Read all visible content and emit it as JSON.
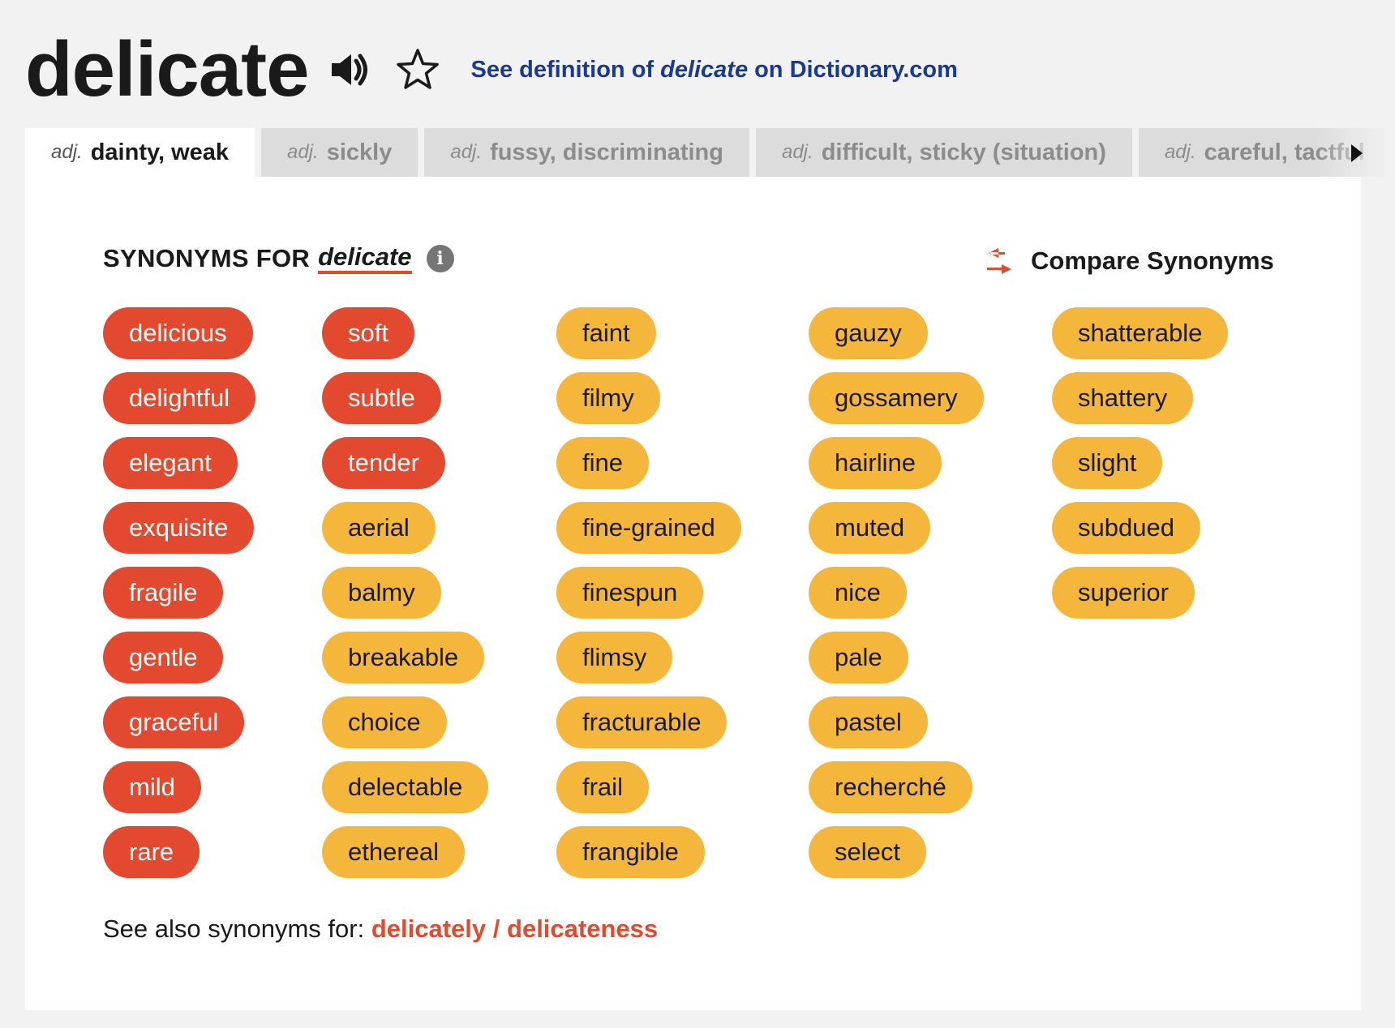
{
  "header": {
    "word": "delicate",
    "definition_link": {
      "prefix": "See definition of",
      "word": "delicate",
      "suffix": "on Dictionary.com"
    }
  },
  "tabs": [
    {
      "pos": "adj.",
      "label": "dainty, weak",
      "active": true
    },
    {
      "pos": "adj.",
      "label": "sickly",
      "active": false
    },
    {
      "pos": "adj.",
      "label": "fussy, discriminating",
      "active": false
    },
    {
      "pos": "adj.",
      "label": "difficult, sticky (situation)",
      "active": false
    },
    {
      "pos": "adj.",
      "label": "careful, tactful",
      "active": false
    }
  ],
  "synonyms_heading": {
    "label": "SYNONYMS FOR",
    "word": "delicate",
    "info_glyph": "i"
  },
  "compare": {
    "label": "Compare Synonyms"
  },
  "columns": [
    [
      {
        "word": "delicious",
        "strength": "strong"
      },
      {
        "word": "delightful",
        "strength": "strong"
      },
      {
        "word": "elegant",
        "strength": "strong"
      },
      {
        "word": "exquisite",
        "strength": "strong"
      },
      {
        "word": "fragile",
        "strength": "strong"
      },
      {
        "word": "gentle",
        "strength": "strong"
      },
      {
        "word": "graceful",
        "strength": "strong"
      },
      {
        "word": "mild",
        "strength": "strong"
      },
      {
        "word": "rare",
        "strength": "strong"
      }
    ],
    [
      {
        "word": "soft",
        "strength": "strong"
      },
      {
        "word": "subtle",
        "strength": "strong"
      },
      {
        "word": "tender",
        "strength": "strong"
      },
      {
        "word": "aerial",
        "strength": "medium"
      },
      {
        "word": "balmy",
        "strength": "medium"
      },
      {
        "word": "breakable",
        "strength": "medium"
      },
      {
        "word": "choice",
        "strength": "medium"
      },
      {
        "word": "delectable",
        "strength": "medium"
      },
      {
        "word": "ethereal",
        "strength": "medium"
      }
    ],
    [
      {
        "word": "faint",
        "strength": "medium"
      },
      {
        "word": "filmy",
        "strength": "medium"
      },
      {
        "word": "fine",
        "strength": "medium"
      },
      {
        "word": "fine-grained",
        "strength": "medium"
      },
      {
        "word": "finespun",
        "strength": "medium"
      },
      {
        "word": "flimsy",
        "strength": "medium"
      },
      {
        "word": "fracturable",
        "strength": "medium"
      },
      {
        "word": "frail",
        "strength": "medium"
      },
      {
        "word": "frangible",
        "strength": "medium"
      }
    ],
    [
      {
        "word": "gauzy",
        "strength": "medium"
      },
      {
        "word": "gossamery",
        "strength": "medium"
      },
      {
        "word": "hairline",
        "strength": "medium"
      },
      {
        "word": "muted",
        "strength": "medium"
      },
      {
        "word": "nice",
        "strength": "medium"
      },
      {
        "word": "pale",
        "strength": "medium"
      },
      {
        "word": "pastel",
        "strength": "medium"
      },
      {
        "word": "recherché",
        "strength": "medium"
      },
      {
        "word": "select",
        "strength": "medium"
      }
    ],
    [
      {
        "word": "shatterable",
        "strength": "medium"
      },
      {
        "word": "shattery",
        "strength": "medium"
      },
      {
        "word": "slight",
        "strength": "medium"
      },
      {
        "word": "subdued",
        "strength": "medium"
      },
      {
        "word": "superior",
        "strength": "medium"
      }
    ]
  ],
  "see_also": {
    "prefix": "See also synonyms for:",
    "links": [
      "delicately",
      "delicateness"
    ],
    "separator": "/"
  },
  "colors": {
    "strong": "#e2492f",
    "medium": "#f5b73b",
    "link_blue": "#1a3a8f",
    "background": "#f2f2f2"
  },
  "icons": {
    "speaker": "speaker-icon",
    "star": "star-icon",
    "info": "info-icon",
    "compare": "compare-arrows-icon",
    "next": "next-arrow-icon"
  }
}
